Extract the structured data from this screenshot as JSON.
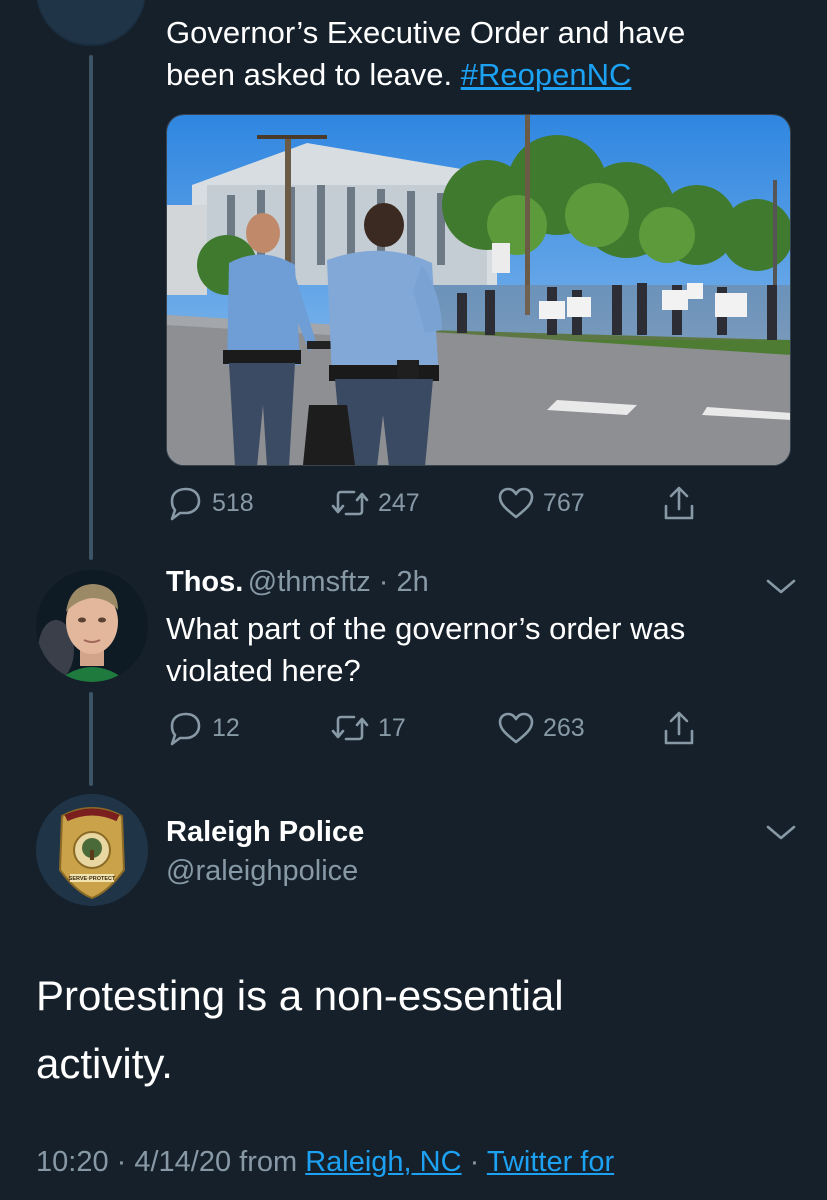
{
  "first_tweet": {
    "text_line1": "Governor’s Executive Order and have",
    "text_line2": "been asked to leave.",
    "hashtag": "#ReopenNC",
    "stats": {
      "replies": "518",
      "retweets": "247",
      "likes": "767"
    }
  },
  "reply_tweet": {
    "name": "Thos.",
    "handle_time": "@thmsftz · 2h",
    "text_line1": "What part of the governor’s order was",
    "text_line2": "violated here?",
    "stats": {
      "replies": "12",
      "retweets": "17",
      "likes": "263"
    }
  },
  "main_tweet": {
    "name": "Raleigh Police",
    "handle": "@raleighpolice",
    "text_line1": "Protesting is a non-essential",
    "text_line2": "activity.",
    "time_date": "10:20 · 4/14/20 from",
    "location": "Raleigh, NC",
    "separator": "·",
    "client": "Twitter for"
  },
  "colors": {
    "background": "#15202b",
    "accent": "#1da1f2",
    "muted": "#8899a6",
    "thread_line": "#3d5466"
  },
  "icons": [
    "reply-icon",
    "retweet-icon",
    "like-icon",
    "share-icon",
    "chevron-down-icon",
    "police-badge-avatar"
  ]
}
